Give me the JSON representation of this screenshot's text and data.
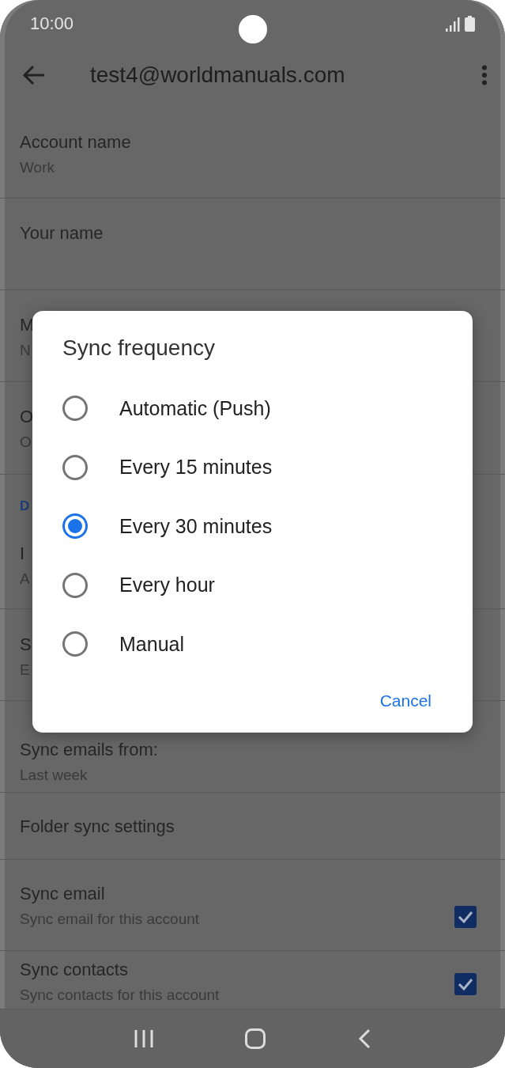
{
  "status_bar": {
    "time": "10:00"
  },
  "app_bar": {
    "title": "test4@worldmanuals.com"
  },
  "settings": [
    {
      "kind": "item",
      "title": "Account name",
      "subtitle": "Work"
    },
    {
      "kind": "item",
      "title": "Your name"
    },
    {
      "kind": "item",
      "title": "M",
      "subtitle": "N"
    },
    {
      "kind": "item",
      "title": "O",
      "subtitle": "O"
    },
    {
      "kind": "header",
      "title": "D"
    },
    {
      "kind": "item",
      "title": "I",
      "subtitle": "A"
    },
    {
      "kind": "item",
      "title": "S",
      "subtitle": "E"
    },
    {
      "kind": "item",
      "title": "Sync emails from:",
      "subtitle": "Last week"
    },
    {
      "kind": "item",
      "title": "Folder sync settings"
    },
    {
      "kind": "check",
      "title": "Sync email",
      "subtitle": "Sync email for this account",
      "checked": true
    },
    {
      "kind": "check",
      "title": "Sync contacts",
      "subtitle": "Sync contacts for this account",
      "checked": true
    }
  ],
  "dialog": {
    "title": "Sync frequency",
    "options": [
      {
        "label": "Automatic (Push)",
        "selected": false
      },
      {
        "label": "Every 15 minutes",
        "selected": false
      },
      {
        "label": "Every 30 minutes",
        "selected": true
      },
      {
        "label": "Every hour",
        "selected": false
      },
      {
        "label": "Manual",
        "selected": false
      }
    ],
    "buttons": [
      "Cancel"
    ]
  }
}
